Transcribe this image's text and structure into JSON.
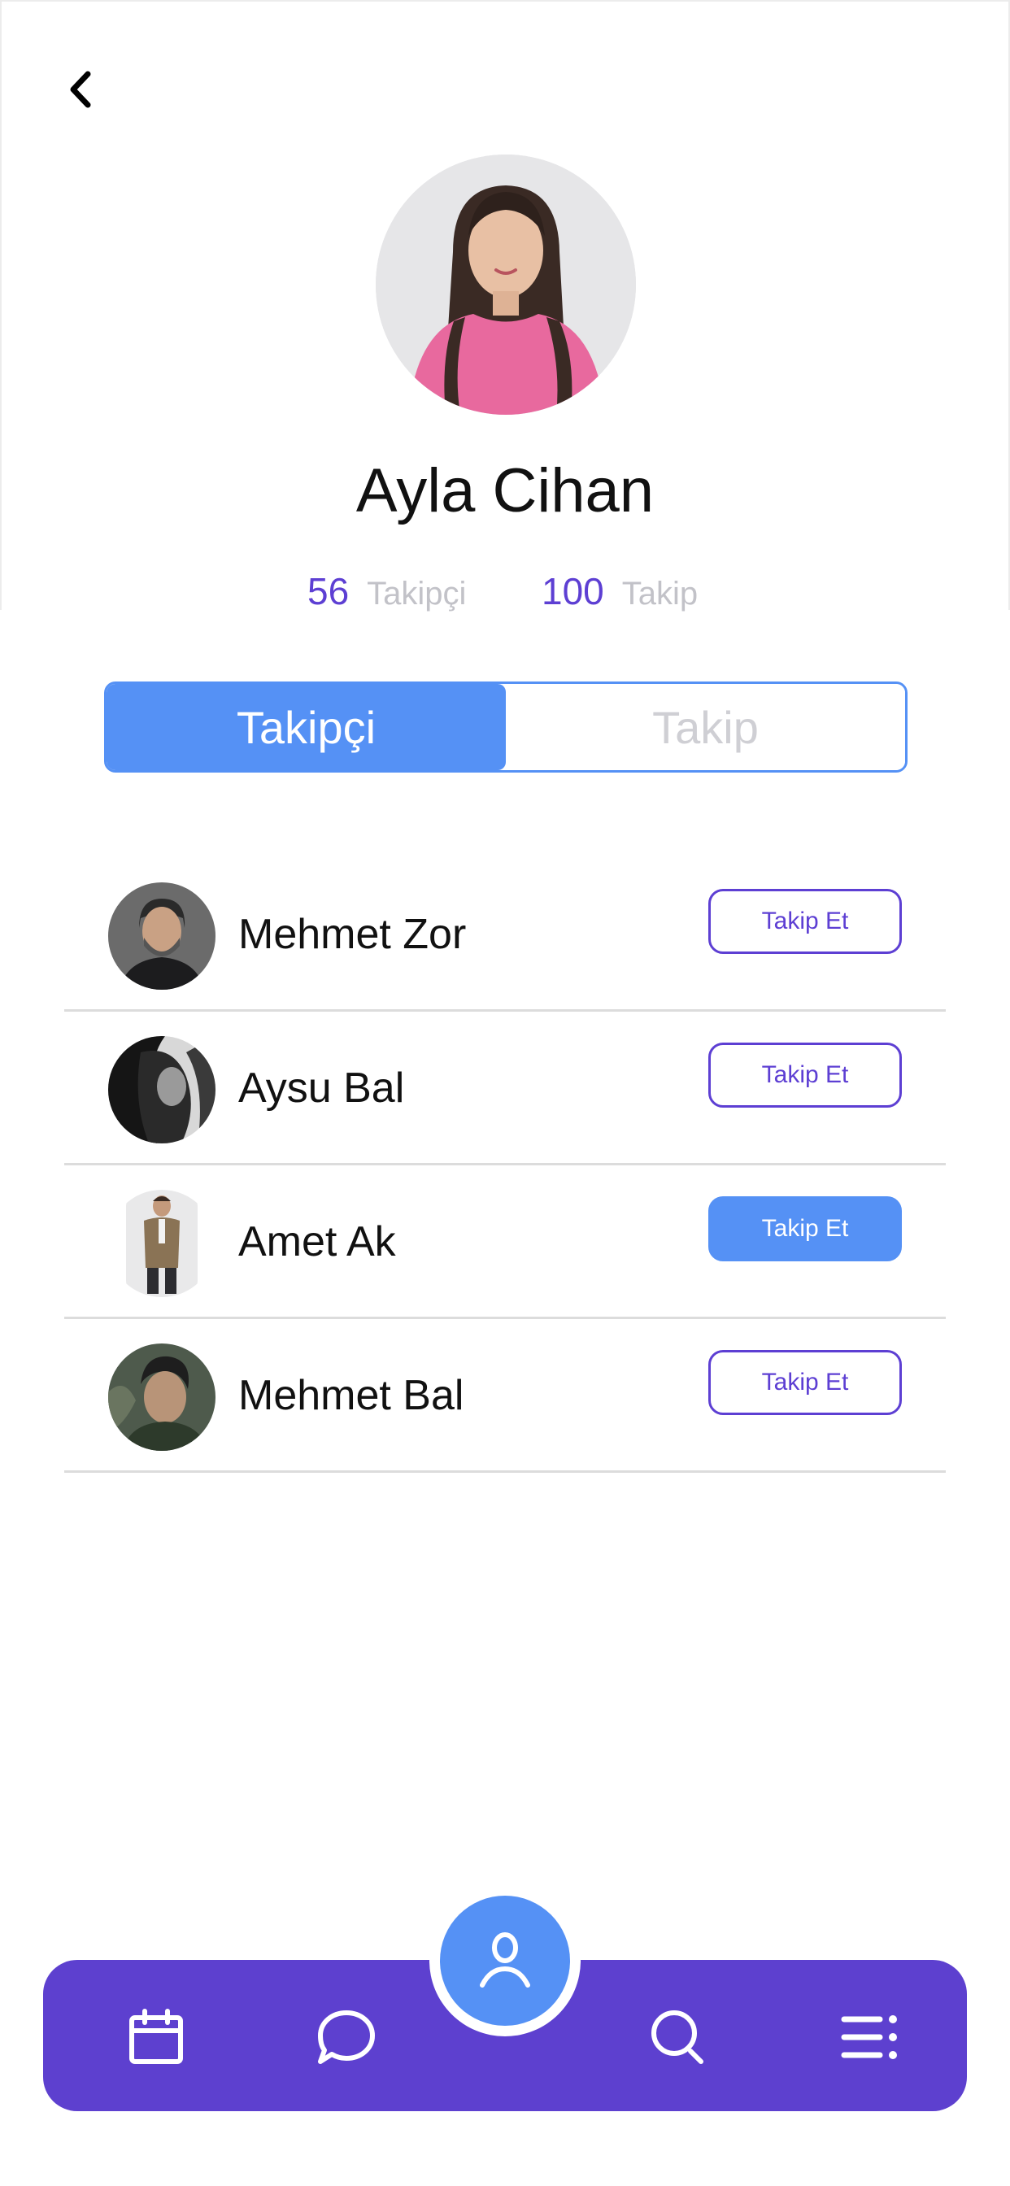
{
  "profile": {
    "name": "Ayla Cihan",
    "followers_count": "56",
    "followers_label": "Takipçi",
    "following_count": "100",
    "following_label": "Takip"
  },
  "segments": {
    "left": "Takipçi",
    "right": "Takip",
    "selected": "Takipçi"
  },
  "users": [
    {
      "name": "Mehmet Zor",
      "button": "Takip Et",
      "button_filled": false
    },
    {
      "name": "Aysu Bal",
      "button": "Takip Et",
      "button_filled": false
    },
    {
      "name": "Amet Ak",
      "button": "Takip Et",
      "button_filled": true
    },
    {
      "name": "Mehmet Bal",
      "button": "Takip Et",
      "button_filled": false
    }
  ],
  "icons": {
    "back": "chevron-left-icon",
    "tab1": "calendar-icon",
    "tab2": "chat-bubble-icon",
    "center": "user-icon",
    "tab4": "search-icon",
    "tab5": "menu-list-icon"
  },
  "colors": {
    "accent_purple": "#5d3fd3",
    "accent_blue": "#5591f5",
    "tabbar": "#5d40cf",
    "muted_text": "#c2c2c8"
  }
}
